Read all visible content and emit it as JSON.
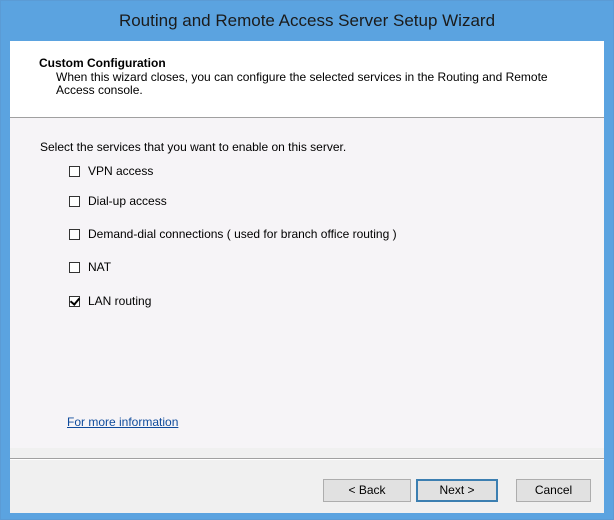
{
  "window": {
    "title": "Routing and Remote Access Server Setup Wizard"
  },
  "header": {
    "title": "Custom Configuration",
    "description": "When this wizard closes, you can configure the selected services in the Routing and Remote Access console."
  },
  "main": {
    "prompt": "Select the services that you want to enable on this server.",
    "options": [
      {
        "label": "VPN access",
        "checked": false
      },
      {
        "label": "Dial-up access",
        "checked": false
      },
      {
        "label": "Demand-dial connections ( used for branch office routing )",
        "checked": false
      },
      {
        "label": "NAT",
        "checked": false
      },
      {
        "label": "LAN routing",
        "checked": true
      }
    ],
    "more_info_link": "For more information"
  },
  "buttons": {
    "back": "< Back",
    "next": "Next >",
    "cancel": "Cancel"
  },
  "colors": {
    "titlebar": "#5ba3e0",
    "link": "#0f4b9c"
  }
}
